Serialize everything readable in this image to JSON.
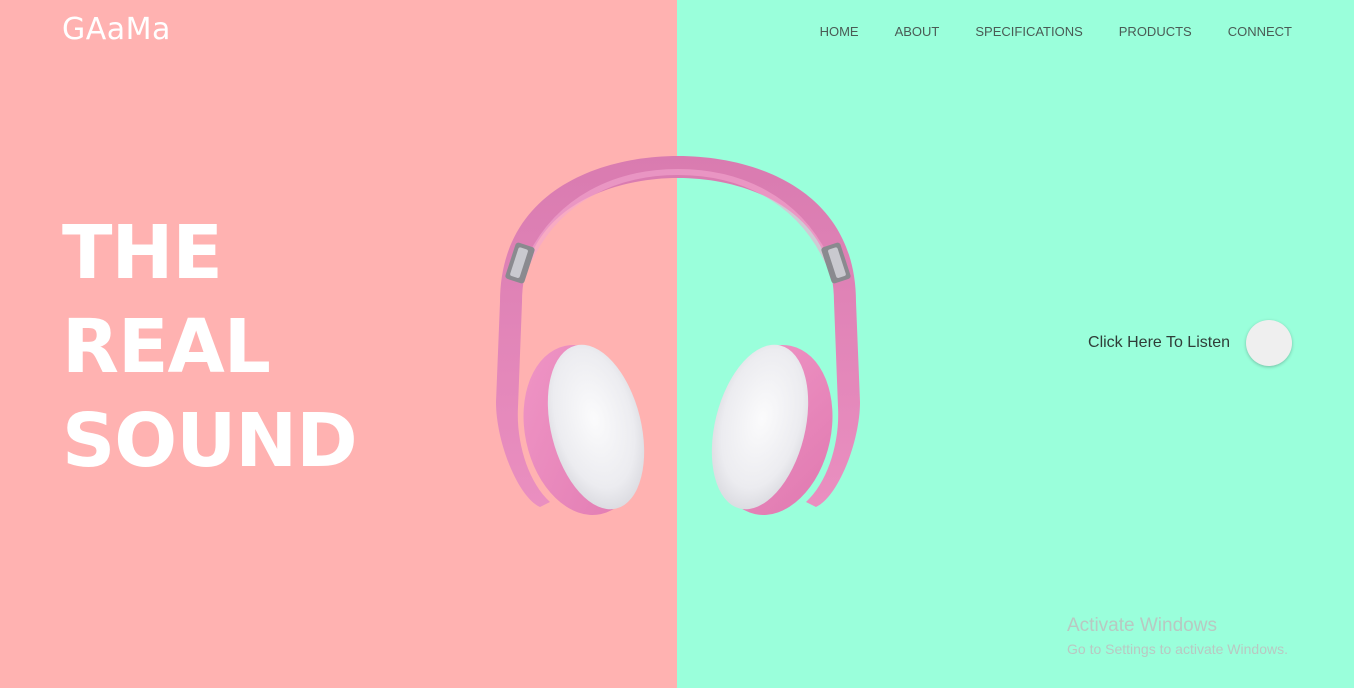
{
  "brand": {
    "logo": "GAaMa"
  },
  "nav": {
    "items": [
      {
        "label": "HOME"
      },
      {
        "label": "ABOUT"
      },
      {
        "label": "SPECIFICATIONS"
      },
      {
        "label": "PRODUCTS"
      },
      {
        "label": "CONNECT"
      }
    ]
  },
  "hero": {
    "headline_lines": [
      "THE",
      "REAL",
      "SOUND"
    ],
    "image_icon": "headphones-pink",
    "cta_label": "Click Here To Listen"
  },
  "colors": {
    "left_bg": "#ffb2b1",
    "right_bg": "#9affdb",
    "headphone_pink": "#e98dbd",
    "cushion_white": "#f2f2f4"
  },
  "watermark": {
    "title": "Activate Windows",
    "subtitle": "Go to Settings to activate Windows."
  }
}
